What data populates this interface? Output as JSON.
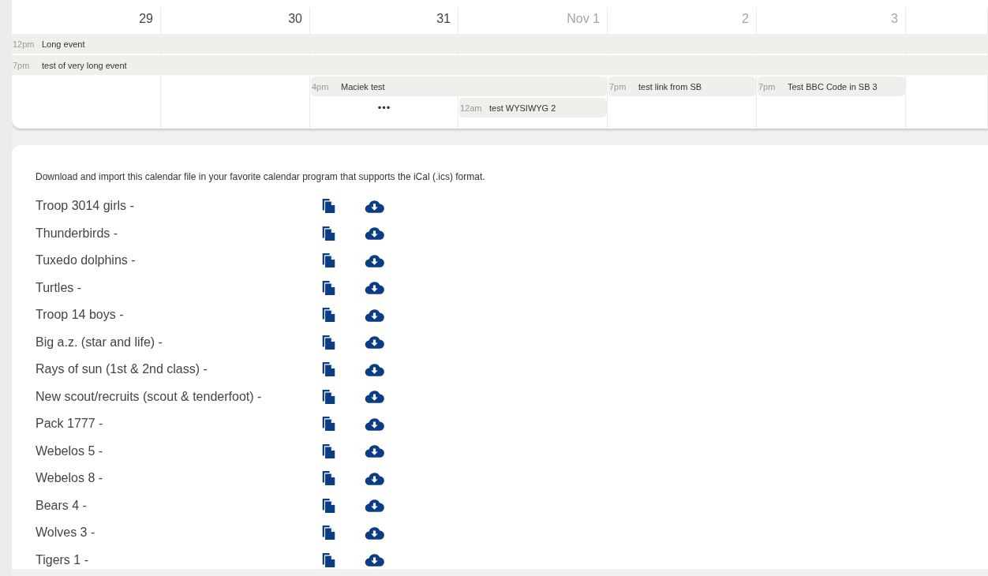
{
  "calendar": {
    "days": [
      {
        "label": "29",
        "other_month": false
      },
      {
        "label": "30",
        "other_month": false
      },
      {
        "label": "31",
        "other_month": false
      },
      {
        "label": "Nov 1",
        "other_month": true
      },
      {
        "label": "2",
        "other_month": true
      },
      {
        "label": "3",
        "other_month": true
      }
    ],
    "lanes": [
      [
        {
          "kind": "event",
          "time": "12pm",
          "title": "Long event"
        },
        {
          "kind": "continued"
        },
        {
          "kind": "continued"
        },
        {
          "kind": "continued"
        },
        {
          "kind": "continued"
        },
        {
          "kind": "continued"
        },
        {
          "kind": "continued"
        }
      ],
      [
        {
          "kind": "event",
          "time": "7pm",
          "title": "test of very long event"
        },
        {
          "kind": "continued"
        },
        {
          "kind": "continued"
        },
        {
          "kind": "continued"
        },
        {
          "kind": "continued"
        },
        {
          "kind": "continued"
        },
        {
          "kind": "continued"
        }
      ],
      [
        {
          "kind": "empty"
        },
        {
          "kind": "empty"
        },
        {
          "kind": "event",
          "time": "4pm",
          "title": "Maciek test"
        },
        {
          "kind": "continued"
        },
        {
          "kind": "event",
          "time": "7pm",
          "title": "test link from SB"
        },
        {
          "kind": "event",
          "time": "7pm",
          "title": "Test BBC Code in SB 3"
        },
        {
          "kind": "empty"
        }
      ],
      [
        {
          "kind": "empty"
        },
        {
          "kind": "empty"
        },
        {
          "kind": "more",
          "label": "•••"
        },
        {
          "kind": "event",
          "time": "12am",
          "title": "test WYSIWYG 2"
        },
        {
          "kind": "empty"
        },
        {
          "kind": "empty"
        },
        {
          "kind": "empty"
        }
      ]
    ]
  },
  "export": {
    "intro": "Download and import this calendar file in your favorite calendar program that supports the iCal (.ics) format.",
    "calendars": [
      {
        "name": "Troop 3014 girls -"
      },
      {
        "name": "Thunderbirds -"
      },
      {
        "name": "Tuxedo dolphins -"
      },
      {
        "name": "Turtles -"
      },
      {
        "name": "Troop 14 boys -"
      },
      {
        "name": "Big a.z. (star and life) -"
      },
      {
        "name": "Rays of sun (1st & 2nd class) -"
      },
      {
        "name": "New scout/recruits (scout & tenderfoot) -"
      },
      {
        "name": "Pack 1777 -"
      },
      {
        "name": "Webelos 5 -"
      },
      {
        "name": "Webelos 8 -"
      },
      {
        "name": "Bears 4 -"
      },
      {
        "name": "Wolves 3 -"
      },
      {
        "name": "Tigers 1 -"
      }
    ]
  }
}
